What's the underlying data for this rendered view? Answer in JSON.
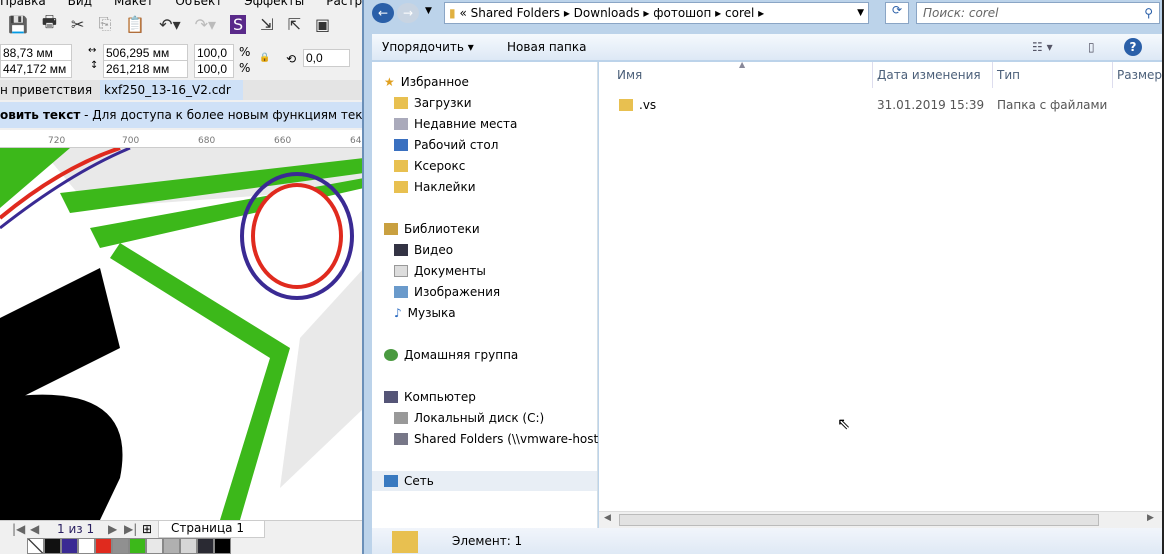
{
  "corel": {
    "menu": [
      "Правка",
      "Вид",
      "Макет",
      "Объект",
      "Эффекты",
      "Растровые изо"
    ],
    "pos_x": "88,73 мм",
    "pos_y": "447,172 мм",
    "width": "506,295 мм",
    "height": "261,218 мм",
    "scale_x": "100,0",
    "scale_y": "100,0",
    "pct": "%",
    "angle": "0,0",
    "tabs": [
      "н приветствия",
      "kxf250_13-16_V2.cdr"
    ],
    "notice_bold": "овить текст",
    "notice": " - Для доступа к более новым функциям текст необх",
    "ruler": [
      "720",
      "700",
      "680",
      "660",
      "640"
    ],
    "page_count": "1 из 1",
    "page_tab": "Страница 1",
    "palette": [
      "#111111",
      "#3a2a93",
      "#ffffff",
      "#e02a1e",
      "#909090",
      "#3cb81a",
      "#e8e8e8",
      "#b0b0b0",
      "#d6d6d6",
      "#2a2a33",
      "#000000"
    ]
  },
  "explorer": {
    "breadcrumb": [
      "«",
      "Shared Folders",
      "Downloads",
      "фотошоп",
      "corel"
    ],
    "search_placeholder": "Поиск: corel",
    "organize": "Упорядочить",
    "new_folder": "Новая папка",
    "nav": {
      "favorites": "Избранное",
      "fav_items": [
        "Загрузки",
        "Недавние места",
        "Рабочий стол",
        "Ксерокс",
        "Наклейки"
      ],
      "libraries": "Библиотеки",
      "lib_items": [
        "Видео",
        "Документы",
        "Изображения",
        "Музыка"
      ],
      "homegroup": "Домашняя группа",
      "computer": "Компьютер",
      "comp_items": [
        "Локальный диск (C:)",
        "Shared Folders (\\\\vmware-host) ("
      ],
      "network": "Сеть"
    },
    "columns": [
      "Имя",
      "Дата изменения",
      "Тип",
      "Размер"
    ],
    "files": [
      {
        "name": ".vs",
        "date": "31.01.2019 15:39",
        "type": "Папка с файлами"
      }
    ],
    "status": "Элемент: 1"
  }
}
